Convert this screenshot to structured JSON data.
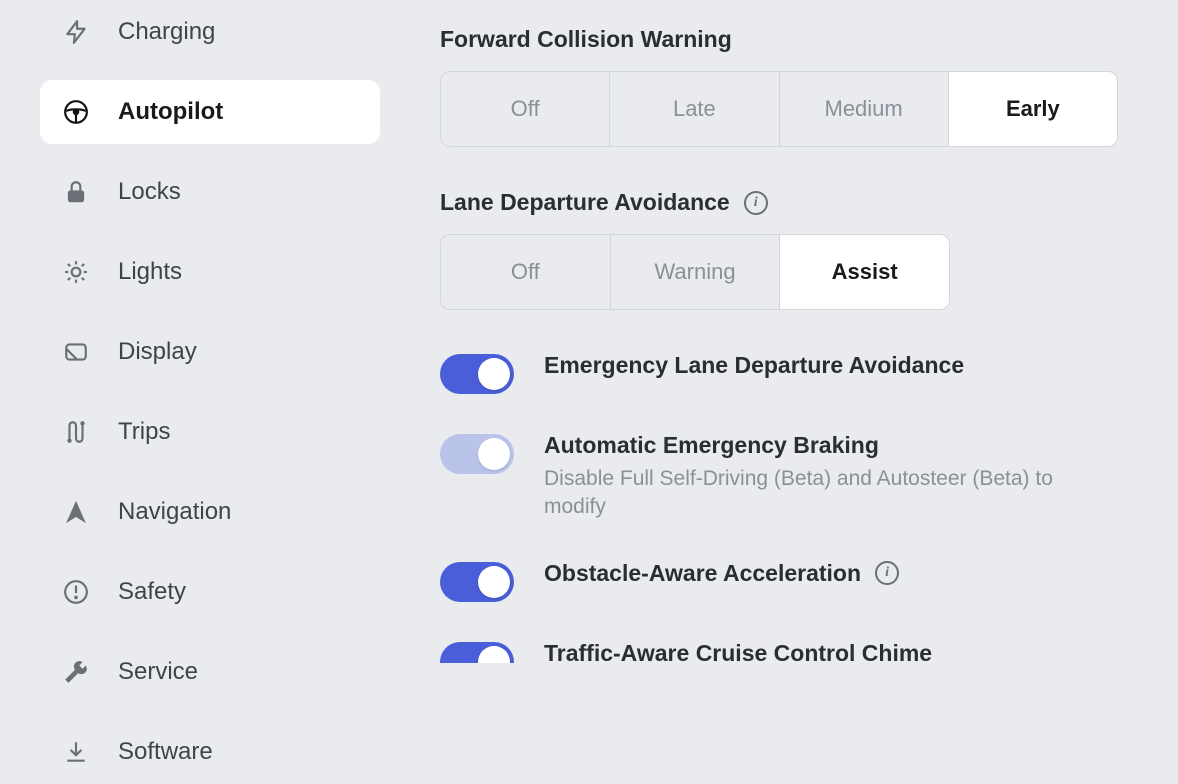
{
  "sidebar": {
    "items": [
      {
        "label": "Charging",
        "icon": "bolt-icon",
        "active": false
      },
      {
        "label": "Autopilot",
        "icon": "steering-icon",
        "active": true
      },
      {
        "label": "Locks",
        "icon": "lock-icon",
        "active": false
      },
      {
        "label": "Lights",
        "icon": "sun-icon",
        "active": false
      },
      {
        "label": "Display",
        "icon": "display-icon",
        "active": false
      },
      {
        "label": "Trips",
        "icon": "trips-icon",
        "active": false
      },
      {
        "label": "Navigation",
        "icon": "nav-icon",
        "active": false
      },
      {
        "label": "Safety",
        "icon": "alert-icon",
        "active": false
      },
      {
        "label": "Service",
        "icon": "wrench-icon",
        "active": false
      },
      {
        "label": "Software",
        "icon": "download-icon",
        "active": false
      }
    ]
  },
  "main": {
    "fcw": {
      "title": "Forward Collision Warning",
      "options": [
        "Off",
        "Late",
        "Medium",
        "Early"
      ],
      "selected": "Early"
    },
    "lda": {
      "title": "Lane Departure Avoidance",
      "options": [
        "Off",
        "Warning",
        "Assist"
      ],
      "selected": "Assist"
    },
    "toggles": {
      "elda": {
        "label": "Emergency Lane Departure Avoidance",
        "on": true,
        "disabled": false
      },
      "aeb": {
        "label": "Automatic Emergency Braking",
        "sub": "Disable Full Self-Driving (Beta) and Autosteer (Beta) to modify",
        "on": true,
        "disabled": true
      },
      "oaa": {
        "label": "Obstacle-Aware Acceleration",
        "on": true,
        "disabled": false,
        "info": true
      },
      "tacc": {
        "label": "Traffic-Aware Cruise Control Chime",
        "on": true,
        "disabled": false
      }
    }
  }
}
